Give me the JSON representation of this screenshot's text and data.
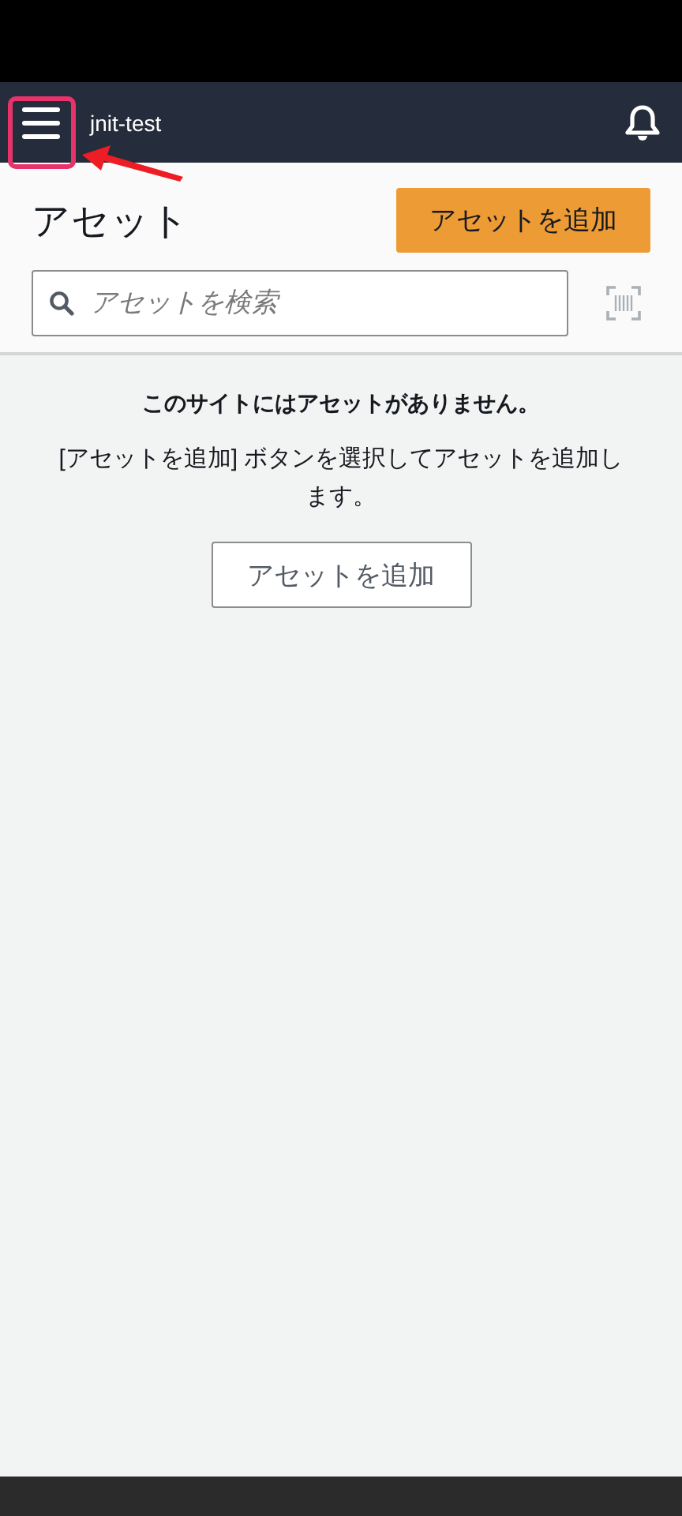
{
  "header": {
    "site_name": "jnit-test"
  },
  "page": {
    "title": "アセット",
    "add_button": "アセットを追加"
  },
  "search": {
    "placeholder": "アセットを検索"
  },
  "empty_state": {
    "heading": "このサイトにはアセットがありません。",
    "message": "[アセットを追加] ボタンを選択してアセットを追加します。",
    "button": "アセットを追加"
  }
}
